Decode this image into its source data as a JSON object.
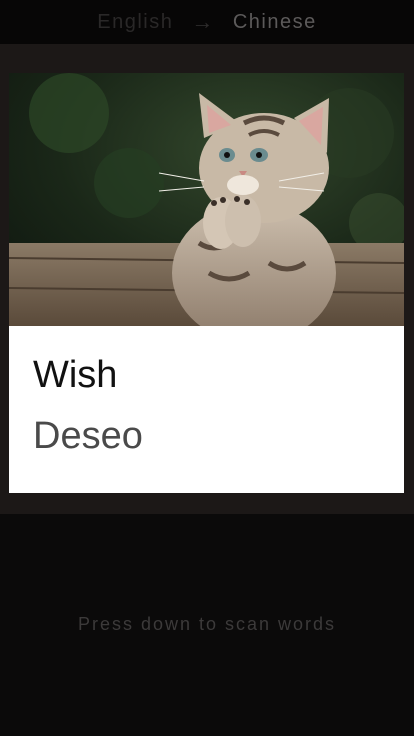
{
  "lang_bar": {
    "source": "English",
    "arrow": "→",
    "target": "Chinese"
  },
  "card": {
    "image_alt": "kitten-praying-photo",
    "word": "Wish",
    "translation": "Deseo"
  },
  "hint": {
    "text": "Press down to scan words"
  }
}
